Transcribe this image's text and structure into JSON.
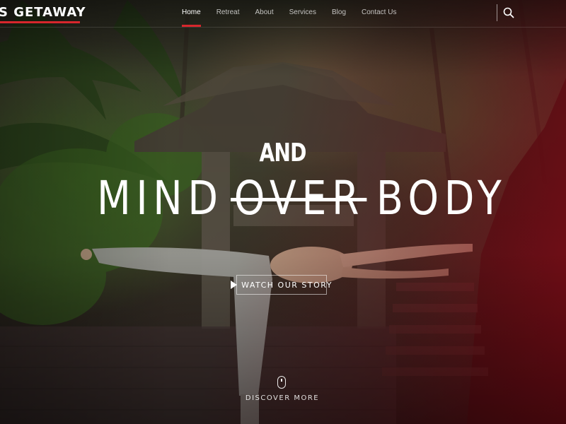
{
  "header": {
    "logo_text": "S GETAWAY",
    "nav": [
      {
        "label": "Home",
        "active": true
      },
      {
        "label": "Retreat",
        "active": false
      },
      {
        "label": "About",
        "active": false
      },
      {
        "label": "Services",
        "active": false
      },
      {
        "label": "Blog",
        "active": false
      },
      {
        "label": "Contact Us",
        "active": false
      }
    ],
    "search_icon": "search-icon"
  },
  "hero": {
    "line1": "AND",
    "word_mind": "MIND",
    "word_over": "OVER",
    "word_body": "BODY",
    "watch_label": "WATCH OUR STORY",
    "discover_label": "DISCOVER MORE"
  },
  "colors": {
    "accent": "#d7262c",
    "text": "#ffffff"
  }
}
